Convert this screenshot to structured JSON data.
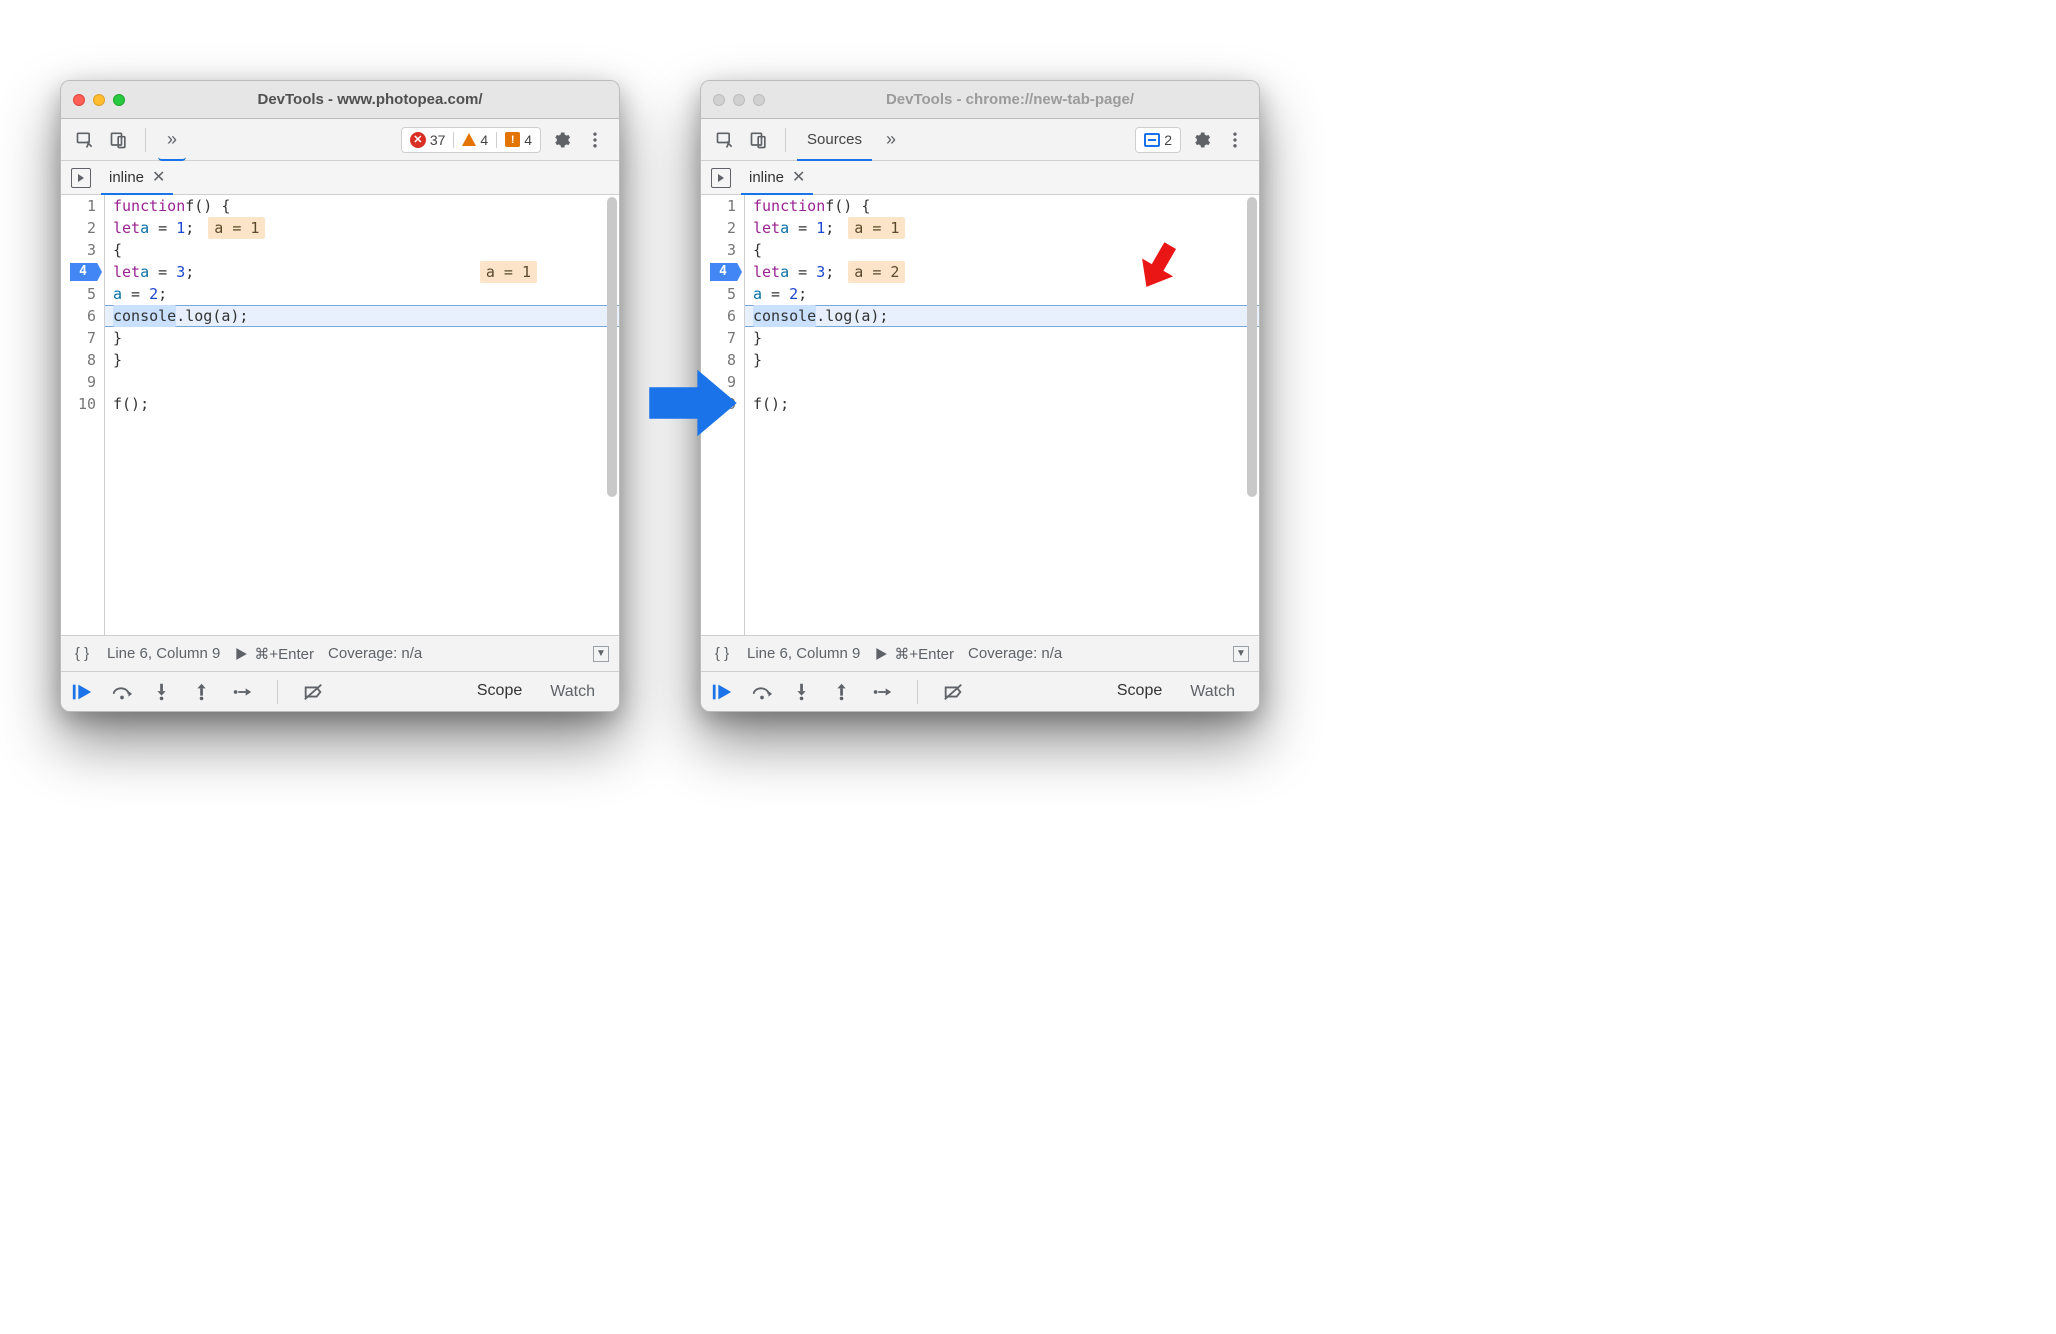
{
  "windows": {
    "left": {
      "title": "DevTools - www.photopea.com/",
      "errors": "37",
      "warnings": "4",
      "info": "4",
      "file_tab": "inline",
      "status_line": "Line 6, Column 9",
      "status_eval": "⌘+Enter",
      "status_coverage": "Coverage: n/a",
      "panel_scope": "Scope",
      "panel_watch": "Watch",
      "annot2": "a = 1",
      "annot4": "a = 1",
      "bp_line": "4",
      "lines": {
        "l1": "1",
        "l2": "2",
        "l3": "3",
        "l4": "4",
        "l5": "5",
        "l6": "6",
        "l7": "7",
        "l8": "8",
        "l9": "9",
        "l10": "10"
      }
    },
    "right": {
      "title": "DevTools - chrome://new-tab-page/",
      "tab_label": "Sources",
      "msg_count": "2",
      "file_tab": "inline",
      "status_line": "Line 6, Column 9",
      "status_eval": "⌘+Enter",
      "status_coverage": "Coverage: n/a",
      "panel_scope": "Scope",
      "panel_watch": "Watch",
      "annot2": "a = 1",
      "annot4": "a = 2",
      "bp_line": "4",
      "lines": {
        "l1": "1",
        "l2": "2",
        "l3": "3",
        "l4": "4",
        "l5": "5",
        "l6": "6",
        "l7": "7",
        "l8": "8",
        "l9": "9",
        "l10": "10"
      }
    }
  },
  "code": {
    "kw_function": "function",
    "fn_name": "f",
    "paren_brace": "() {",
    "kw_let": "let",
    "id_a": "a",
    "eq": " = ",
    "n1": "1",
    "n2": "2",
    "n3": "3",
    "semi": ";",
    "obrace": "{",
    "cbrace": "}",
    "console": "console",
    "dot_log": ".log(a);",
    "call": "f();"
  }
}
